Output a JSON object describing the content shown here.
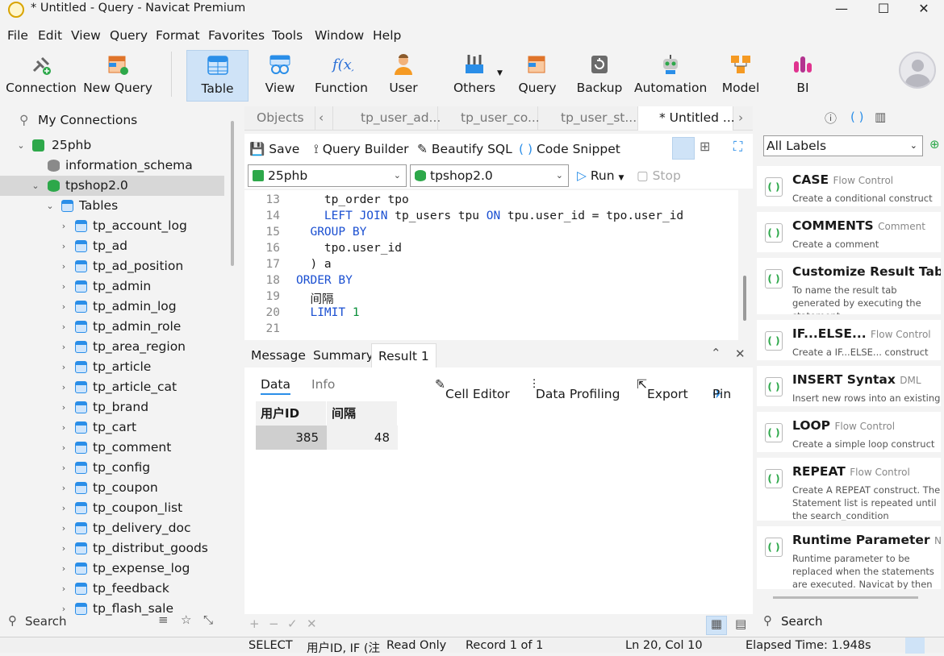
{
  "window": {
    "title": "* Untitled - Query - Navicat Premium"
  },
  "menu": [
    "File",
    "Edit",
    "View",
    "Query",
    "Format",
    "Favorites",
    "Tools",
    "Window",
    "Help"
  ],
  "toolbar": {
    "connection": "Connection",
    "new_query": "New Query",
    "table": "Table",
    "view": "View",
    "function": "Function",
    "user": "User",
    "others": "Others",
    "query": "Query",
    "backup": "Backup",
    "automation": "Automation",
    "model": "Model",
    "bi": "BI"
  },
  "tree": {
    "root": "My Connections",
    "connection": "25phb",
    "db1": "information_schema",
    "db2": "tpshop2.0",
    "tables_label": "Tables",
    "tables": [
      "tp_account_log",
      "tp_ad",
      "tp_ad_position",
      "tp_admin",
      "tp_admin_log",
      "tp_admin_role",
      "tp_area_region",
      "tp_article",
      "tp_article_cat",
      "tp_brand",
      "tp_cart",
      "tp_comment",
      "tp_config",
      "tp_coupon",
      "tp_coupon_list",
      "tp_delivery_doc",
      "tp_distribut_goods",
      "tp_expense_log",
      "tp_feedback",
      "tp_flash_sale"
    ]
  },
  "left_search": "Search",
  "tabs": [
    "Objects",
    "tp_user_ad...",
    "tp_user_co...",
    "tp_user_st...",
    "* Untitled ..."
  ],
  "query_toolbar": {
    "save": "Save",
    "builder": "Query Builder",
    "beautify": "Beautify SQL",
    "snippet": "Code Snippet"
  },
  "selectors": {
    "connection": "25phb",
    "database": "tpshop2.0",
    "run": "Run",
    "stop": "Stop"
  },
  "editor": {
    "lines": [
      {
        "n": "13",
        "html": "    tp_order tpo"
      },
      {
        "n": "14",
        "html": "    <span class='kw'>LEFT JOIN</span> tp_users tpu <span class='kw'>ON</span> tpu.user_id = tpo.user_id"
      },
      {
        "n": "15",
        "html": "  <span class='kw'>GROUP BY</span>"
      },
      {
        "n": "16",
        "html": "    tpo.user_id"
      },
      {
        "n": "17",
        "html": "  ) a"
      },
      {
        "n": "18",
        "html": "<span class='kw'>ORDER BY</span>"
      },
      {
        "n": "19",
        "html": "  间隔"
      },
      {
        "n": "20",
        "html": "  <span class='kw'>LIMIT</span> <span class='num'>1</span>"
      },
      {
        "n": "21",
        "html": ""
      }
    ]
  },
  "result_tabs": [
    "Message",
    "Summary",
    "Result 1"
  ],
  "result_sub": {
    "data": "Data",
    "info": "Info",
    "cell_editor": "Cell Editor",
    "profiling": "Data Profiling",
    "export": "Export",
    "pin": "Pin"
  },
  "result_grid": {
    "headers": [
      "用户ID",
      "间隔"
    ],
    "rows": [
      [
        "385",
        "48"
      ]
    ]
  },
  "status": {
    "type": "SELECT",
    "fields": "用户ID, IF (注",
    "mode": "Read Only",
    "record": "Record 1 of 1",
    "pos": "Ln 20, Col 10",
    "elapsed": "Elapsed Time: 1.948s"
  },
  "right_panel": {
    "filter": "All Labels",
    "snippets": [
      {
        "title": "CASE",
        "tag": "Flow Control",
        "desc": "Create a conditional construct"
      },
      {
        "title": "COMMENTS",
        "tag": "Comment",
        "desc": "Create a comment"
      },
      {
        "title": "Customize Result Tab",
        "tag": "",
        "desc": "To name the result tab generated by executing the statement."
      },
      {
        "title": "IF...ELSE...",
        "tag": "Flow Control",
        "desc": "Create a IF...ELSE... construct"
      },
      {
        "title": "INSERT Syntax",
        "tag": "DML",
        "desc": "Insert new rows into an existing table"
      },
      {
        "title": "LOOP",
        "tag": "Flow Control",
        "desc": "Create a simple loop construct"
      },
      {
        "title": "REPEAT",
        "tag": "Flow Control",
        "desc": "Create A REPEAT construct. The Statement list is repeated until the search_condition expression is true"
      },
      {
        "title": "Runtime Parameter",
        "tag": "Nav",
        "desc": "Runtime parameter to be replaced when the statements are executed. Navicat by then will pop a dialog for you to input value"
      }
    ],
    "search": "Search"
  },
  "colors": {
    "accent": "#1a4fd1",
    "active_tool": "#cfe3f7",
    "selection": "#d7d7d7"
  }
}
